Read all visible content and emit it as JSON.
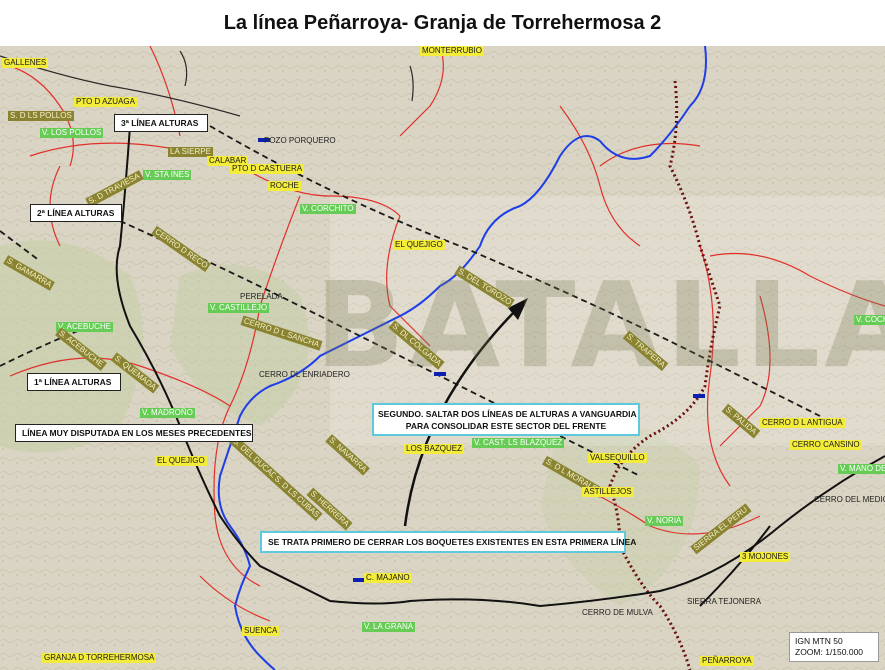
{
  "title": "La línea Peñarroya- Granja de Torrehermosa 2",
  "watermark": "BATALLAS",
  "callouts": {
    "line3": "3ª LÍNEA ALTURAS",
    "line2": "2ª LÍNEA ALTURAS",
    "line1": "1ª LÍNEA ALTURAS",
    "disputed": "LÍNEA MUY DISPUTADA EN LOS MESES PRECEDENTES",
    "second_1": "SEGUNDO. SALTAR DOS LÍNEAS DE ALTURAS A VANGUARDIA",
    "second_2": "PARA CONSOLIDAR ESTE SECTOR DEL FRENTE",
    "first": "SE TRATA PRIMERO DE CERRAR LOS BOQUETES EXISTENTES EN ESTA PRIMERA LÍNEA"
  },
  "info": {
    "source": "IGN MTN 50",
    "zoom": "ZOOM: 1/150.000"
  },
  "places": {
    "gallenes": "GALLENES",
    "monterrubio": "MONTERRUBIO",
    "pto_azuaga": "PTO D AZUAGA",
    "sdlspollos": "S. D LS POLLOS",
    "vlospollos": "V. LOS POLLOS",
    "laserpe": "LA SIERPE",
    "calabar": "CALABAR",
    "pto_castuera": "PTO D CASTUERA",
    "pozo_porquero": "POZO PORQUERO",
    "vstaines": "V. STA INES",
    "roche": "ROCHE",
    "vcorchito": "V. CORCHITO",
    "traviesa": "S. D TRAVIESA",
    "elquejigo_top": "EL QUEJIGO",
    "recorvo": "CERRO D RECO",
    "sdeltorozo": "S. DEL TOROZO",
    "gamarra": "S. GAMARRA",
    "perelada": "PERELADA",
    "vcastillejo": "V. CASTILLEJO",
    "cerrosancha": "CERRO D L SANCHA",
    "vacebuche": "V. ACEBUCHE",
    "acebuche": "S. ACEBUCHE",
    "quemada": "S. QUEMADA",
    "colgada": "S. DL COLGADA",
    "enriadero": "CERRO DL ENRIADERO",
    "vcoche": "V. COCHE",
    "trapera": "S. TRAPERA",
    "vmadrono": "V. MADROÑO",
    "palida": "S. PALIDA",
    "cerroantigua": "CERRO D L ANTIGUA",
    "elquejigo_low": "EL QUEJIGO",
    "delducado": "S. DEL DUCADO",
    "navarra": "S. NAVARRA",
    "losbazquez": "LOS BAZQUEZ",
    "vcastblazquez": "V. CAST. LS BLAZQUEZ",
    "cerrocansino": "CERRO CANSINO",
    "valsequillo": "VALSEQUILLO",
    "sdlmorales": "S. D L MORALES",
    "astillejos": "ASTILLEJOS",
    "vmanode": "V. MANO DE",
    "cerrodelmedico": "CERRO DEL MEDICO",
    "lscubas": "S. D LS CUBAS",
    "herrera": "S. HERRERA",
    "vnoria": "V. NORIA",
    "sierraperu": "SIERRA EL PERU",
    "mojones": "3 MOJONES",
    "cmajano": "C. MAJANO",
    "sierratejonera": "SIERRA TEJONERA",
    "vlagrana": "V. LA GRANA",
    "suenca": "SUENCA",
    "granja": "GRANJA D TORREHERMOSA",
    "penarroya": "PEÑARROYA",
    "cerromulva": "CERRO DE MULVA",
    "fuente": "FUENTE"
  }
}
